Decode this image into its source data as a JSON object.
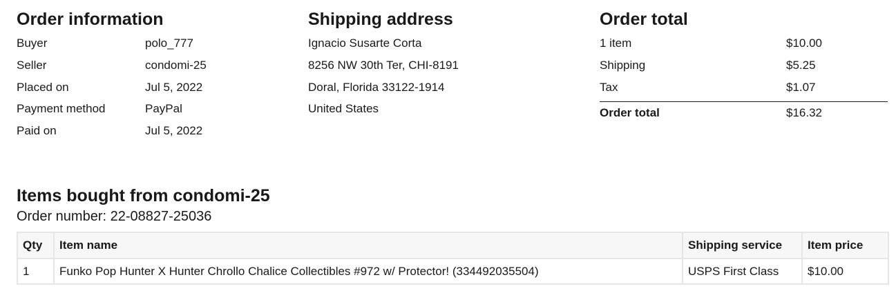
{
  "order_information": {
    "title": "Order information",
    "rows": [
      {
        "label": "Buyer",
        "value": "polo_777"
      },
      {
        "label": "Seller",
        "value": "condomi-25"
      },
      {
        "label": "Placed on",
        "value": "Jul 5, 2022"
      },
      {
        "label": "Payment method",
        "value": "PayPal"
      },
      {
        "label": "Paid on",
        "value": "Jul 5, 2022"
      }
    ]
  },
  "shipping_address": {
    "title": "Shipping address",
    "lines": [
      "Ignacio Susarte Corta",
      "8256 NW 30th Ter, CHI-8191",
      "Doral, Florida 33122-1914",
      "United States"
    ]
  },
  "order_total": {
    "title": "Order total",
    "rows": [
      {
        "label": "1 item",
        "value": "$10.00"
      },
      {
        "label": "Shipping",
        "value": "$5.25"
      },
      {
        "label": "Tax",
        "value": "$1.07"
      }
    ],
    "total_label": "Order total",
    "total_value": "$16.32"
  },
  "items": {
    "title": "Items bought from condomi-25",
    "order_number": "Order number: 22-08827-25036",
    "headers": [
      "Qty",
      "Item name",
      "Shipping service",
      "Item price"
    ],
    "rows": [
      {
        "qty": "1",
        "name": "Funko Pop Hunter X Hunter Chrollo Chalice Collectibles #972 w/ Protector! (334492035504)",
        "shipping_service": "USPS First Class",
        "price": "$10.00"
      }
    ]
  }
}
